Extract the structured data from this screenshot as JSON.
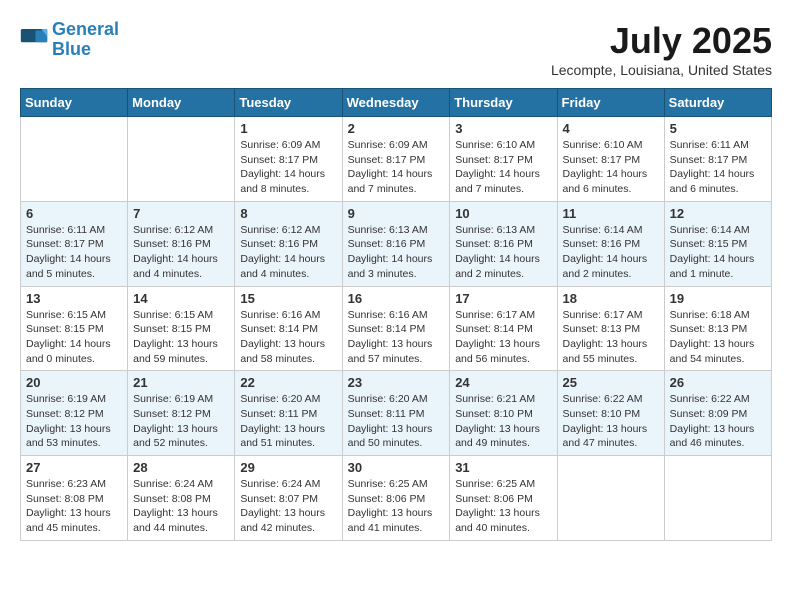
{
  "header": {
    "logo_line1": "General",
    "logo_line2": "Blue",
    "month_year": "July 2025",
    "location": "Lecompte, Louisiana, United States"
  },
  "weekdays": [
    "Sunday",
    "Monday",
    "Tuesday",
    "Wednesday",
    "Thursday",
    "Friday",
    "Saturday"
  ],
  "weeks": [
    [
      {
        "day": "",
        "info": ""
      },
      {
        "day": "",
        "info": ""
      },
      {
        "day": "1",
        "info": "Sunrise: 6:09 AM\nSunset: 8:17 PM\nDaylight: 14 hours and 8 minutes."
      },
      {
        "day": "2",
        "info": "Sunrise: 6:09 AM\nSunset: 8:17 PM\nDaylight: 14 hours and 7 minutes."
      },
      {
        "day": "3",
        "info": "Sunrise: 6:10 AM\nSunset: 8:17 PM\nDaylight: 14 hours and 7 minutes."
      },
      {
        "day": "4",
        "info": "Sunrise: 6:10 AM\nSunset: 8:17 PM\nDaylight: 14 hours and 6 minutes."
      },
      {
        "day": "5",
        "info": "Sunrise: 6:11 AM\nSunset: 8:17 PM\nDaylight: 14 hours and 6 minutes."
      }
    ],
    [
      {
        "day": "6",
        "info": "Sunrise: 6:11 AM\nSunset: 8:17 PM\nDaylight: 14 hours and 5 minutes."
      },
      {
        "day": "7",
        "info": "Sunrise: 6:12 AM\nSunset: 8:16 PM\nDaylight: 14 hours and 4 minutes."
      },
      {
        "day": "8",
        "info": "Sunrise: 6:12 AM\nSunset: 8:16 PM\nDaylight: 14 hours and 4 minutes."
      },
      {
        "day": "9",
        "info": "Sunrise: 6:13 AM\nSunset: 8:16 PM\nDaylight: 14 hours and 3 minutes."
      },
      {
        "day": "10",
        "info": "Sunrise: 6:13 AM\nSunset: 8:16 PM\nDaylight: 14 hours and 2 minutes."
      },
      {
        "day": "11",
        "info": "Sunrise: 6:14 AM\nSunset: 8:16 PM\nDaylight: 14 hours and 2 minutes."
      },
      {
        "day": "12",
        "info": "Sunrise: 6:14 AM\nSunset: 8:15 PM\nDaylight: 14 hours and 1 minute."
      }
    ],
    [
      {
        "day": "13",
        "info": "Sunrise: 6:15 AM\nSunset: 8:15 PM\nDaylight: 14 hours and 0 minutes."
      },
      {
        "day": "14",
        "info": "Sunrise: 6:15 AM\nSunset: 8:15 PM\nDaylight: 13 hours and 59 minutes."
      },
      {
        "day": "15",
        "info": "Sunrise: 6:16 AM\nSunset: 8:14 PM\nDaylight: 13 hours and 58 minutes."
      },
      {
        "day": "16",
        "info": "Sunrise: 6:16 AM\nSunset: 8:14 PM\nDaylight: 13 hours and 57 minutes."
      },
      {
        "day": "17",
        "info": "Sunrise: 6:17 AM\nSunset: 8:14 PM\nDaylight: 13 hours and 56 minutes."
      },
      {
        "day": "18",
        "info": "Sunrise: 6:17 AM\nSunset: 8:13 PM\nDaylight: 13 hours and 55 minutes."
      },
      {
        "day": "19",
        "info": "Sunrise: 6:18 AM\nSunset: 8:13 PM\nDaylight: 13 hours and 54 minutes."
      }
    ],
    [
      {
        "day": "20",
        "info": "Sunrise: 6:19 AM\nSunset: 8:12 PM\nDaylight: 13 hours and 53 minutes."
      },
      {
        "day": "21",
        "info": "Sunrise: 6:19 AM\nSunset: 8:12 PM\nDaylight: 13 hours and 52 minutes."
      },
      {
        "day": "22",
        "info": "Sunrise: 6:20 AM\nSunset: 8:11 PM\nDaylight: 13 hours and 51 minutes."
      },
      {
        "day": "23",
        "info": "Sunrise: 6:20 AM\nSunset: 8:11 PM\nDaylight: 13 hours and 50 minutes."
      },
      {
        "day": "24",
        "info": "Sunrise: 6:21 AM\nSunset: 8:10 PM\nDaylight: 13 hours and 49 minutes."
      },
      {
        "day": "25",
        "info": "Sunrise: 6:22 AM\nSunset: 8:10 PM\nDaylight: 13 hours and 47 minutes."
      },
      {
        "day": "26",
        "info": "Sunrise: 6:22 AM\nSunset: 8:09 PM\nDaylight: 13 hours and 46 minutes."
      }
    ],
    [
      {
        "day": "27",
        "info": "Sunrise: 6:23 AM\nSunset: 8:08 PM\nDaylight: 13 hours and 45 minutes."
      },
      {
        "day": "28",
        "info": "Sunrise: 6:24 AM\nSunset: 8:08 PM\nDaylight: 13 hours and 44 minutes."
      },
      {
        "day": "29",
        "info": "Sunrise: 6:24 AM\nSunset: 8:07 PM\nDaylight: 13 hours and 42 minutes."
      },
      {
        "day": "30",
        "info": "Sunrise: 6:25 AM\nSunset: 8:06 PM\nDaylight: 13 hours and 41 minutes."
      },
      {
        "day": "31",
        "info": "Sunrise: 6:25 AM\nSunset: 8:06 PM\nDaylight: 13 hours and 40 minutes."
      },
      {
        "day": "",
        "info": ""
      },
      {
        "day": "",
        "info": ""
      }
    ]
  ]
}
